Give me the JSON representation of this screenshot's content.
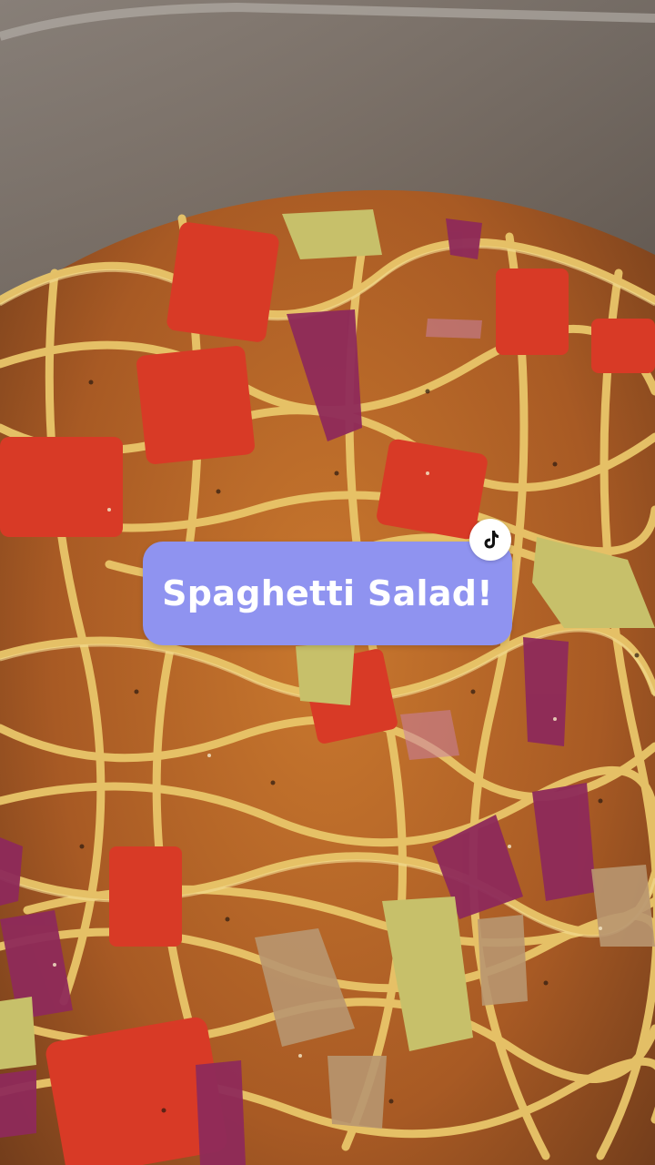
{
  "caption": {
    "text": "Spaghetti Salad!",
    "background_color": "#8f93f0",
    "text_color": "#ffffff"
  },
  "badge": {
    "icon": "tiktok-icon"
  },
  "photo": {
    "subject_icon": "spaghetti-salad-photo"
  }
}
